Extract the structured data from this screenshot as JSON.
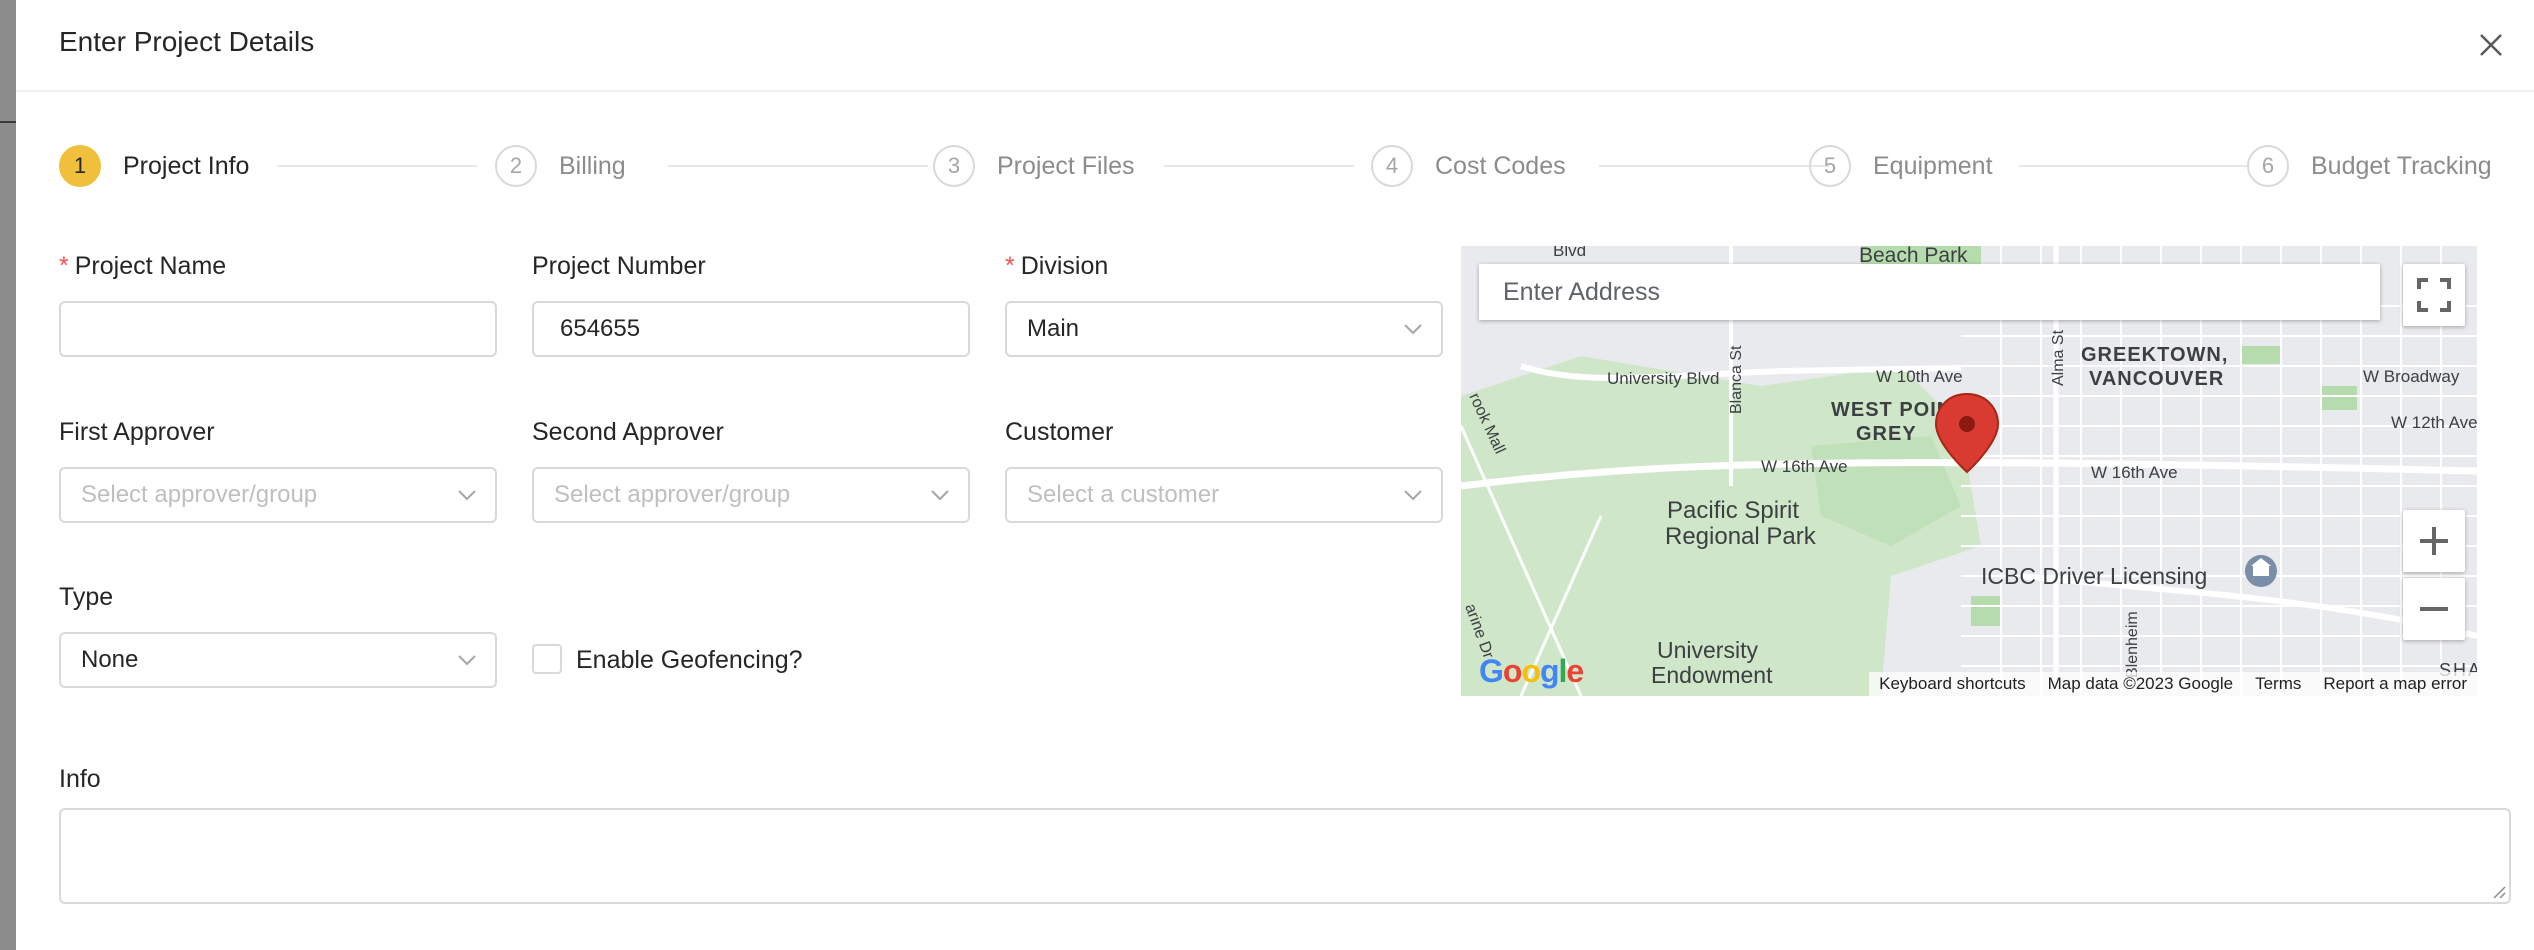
{
  "modal": {
    "title": "Enter Project Details",
    "close_label": "×"
  },
  "steps": [
    {
      "number": "1",
      "label": "Project Info",
      "active": true
    },
    {
      "number": "2",
      "label": "Billing"
    },
    {
      "number": "3",
      "label": "Project Files"
    },
    {
      "number": "4",
      "label": "Cost Codes"
    },
    {
      "number": "5",
      "label": "Equipment"
    },
    {
      "number": "6",
      "label": "Budget Tracking"
    }
  ],
  "form": {
    "required_mark": "*",
    "project_name": {
      "label": "Project Name",
      "value": ""
    },
    "project_number": {
      "label": "Project Number",
      "value": "654655"
    },
    "division": {
      "label": "Division",
      "value": "Main"
    },
    "first_approver": {
      "label": "First Approver",
      "placeholder": "Select approver/group"
    },
    "second_approver": {
      "label": "Second Approver",
      "placeholder": "Select approver/group"
    },
    "customer": {
      "label": "Customer",
      "placeholder": "Select a customer"
    },
    "type": {
      "label": "Type",
      "value": "None"
    },
    "geofencing": {
      "label": "Enable Geofencing?",
      "checked": false
    },
    "info": {
      "label": "Info",
      "value": ""
    }
  },
  "map": {
    "address_placeholder": "Enter Address",
    "labels": {
      "beach_park": "Beach Park",
      "greektown_1": "GREEKTOWN,",
      "greektown_2": "VANCOUVER",
      "west_point_1": "WEST POINT",
      "west_point_2": "GREY",
      "pacific_1": "Pacific Spirit",
      "pacific_2": "Regional Park",
      "icbc": "ICBC Driver Licensing",
      "university_1": "University",
      "university_2": "Endowment",
      "university_blvd": "University Blvd",
      "w10": "W 10th Ave",
      "w12": "W 12th Ave",
      "w16a": "W 16th Ave",
      "w16b": "W 16th Ave",
      "broadway": "W Broadway",
      "blanca": "Blanca St",
      "alma": "Alma St",
      "blenheim": "Blenheim",
      "brook_mall": "rook Mall",
      "marine_dr": "arine Dr",
      "blvd": "Blvd",
      "sha": "SHA"
    },
    "google": [
      "G",
      "o",
      "o",
      "g",
      "l",
      "e"
    ],
    "google_colors": [
      "#4285F4",
      "#EA4335",
      "#FBBC05",
      "#4285F4",
      "#34A853",
      "#EA4335"
    ],
    "footer": {
      "shortcuts": "Keyboard shortcuts",
      "data": "Map data ©2023 Google",
      "terms": "Terms",
      "report": "Report a map error"
    },
    "zoom_in": "+",
    "zoom_out": "−"
  }
}
